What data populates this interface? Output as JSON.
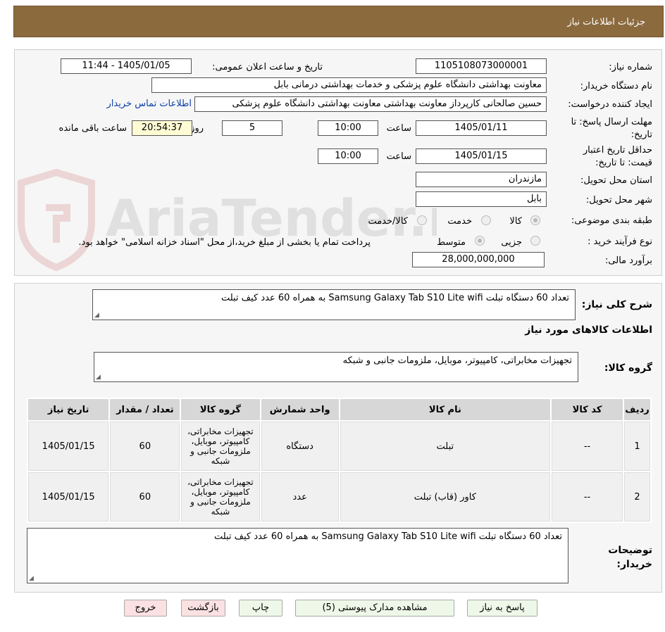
{
  "header": {
    "title": "جزئیات اطلاعات نیاز"
  },
  "form": {
    "need_number_label": "شماره نیاز:",
    "need_number": "1105108073000001",
    "announce_label": "تاریخ و ساعت اعلان عمومی:",
    "announce_value": "1405/01/05 - 11:44",
    "buyer_org_label": "نام دستگاه خریدار:",
    "buyer_org": "معاونت بهداشتی دانشگاه علوم پزشکی و خدمات بهداشتی درمانی بابل",
    "creator_label": "ایجاد کننده درخواست:",
    "creator": "حسین صالحانی کارپرداز معاونت بهداشتی معاونت بهداشتی دانشگاه علوم پزشکی",
    "contact_link": "اطلاعات تماس خریدار",
    "deadline_label": "مهلت ارسال پاسخ: تا تاریخ:",
    "deadline_date": "1405/01/11",
    "time_label": "ساعت",
    "deadline_time": "10:00",
    "days_value": "5",
    "days_label": "روز و",
    "remaining_value": "20:54:37",
    "remaining_label": "ساعت باقی مانده",
    "validity_label": "حداقل تاریخ اعتبار قیمت: تا تاریخ:",
    "validity_date": "1405/01/15",
    "validity_time_label": "ساعت",
    "validity_time": "10:00",
    "province_label": "استان محل تحویل:",
    "province": "مازندران",
    "city_label": "شهر محل تحویل:",
    "city": "بابل",
    "category_label": "طبقه بندی موضوعی:",
    "category_options": [
      "کالا",
      "خدمت",
      "کالا/خدمت"
    ],
    "category_selected": "کالا",
    "process_label": "نوع فرآیند خرید :",
    "process_options": [
      "جزیی",
      "متوسط"
    ],
    "process_selected": "متوسط",
    "payment_note": "پرداخت تمام یا بخشی از مبلغ خرید،از محل \"اسناد خزانه اسلامی\" خواهد بود.",
    "budget_label": "برآورد مالی:",
    "budget": "28,000,000,000"
  },
  "summary": {
    "label": "شرح کلی نیاز:",
    "text": "تعداد 60 دستگاه تبلت Samsung    Galaxy Tab S10  Lite wifi  به همراه   60 عدد کیف تبلت"
  },
  "goods": {
    "section_title": "اطلاعات کالاهای مورد نیاز",
    "group_label": "گروه کالا:",
    "group_value": "تجهیزات مخابراتی، کامپیوتر، موبایل، ملزومات جانبی و شبکه",
    "columns": [
      "ردیف",
      "کد کالا",
      "نام کالا",
      "واحد شمارش",
      "گروه کالا",
      "تعداد / مقدار",
      "تاریخ نیاز"
    ],
    "rows": [
      {
        "row": "1",
        "code": "--",
        "name": "تبلت",
        "unit": "دستگاه",
        "group": "تجهیزات مخابراتی، کامپیوتر، موبایل، ملزومات جانبی و شبکه",
        "qty": "60",
        "date": "1405/01/15"
      },
      {
        "row": "2",
        "code": "--",
        "name": "کاور (قاب) تبلت",
        "unit": "عدد",
        "group": "تجهیزات مخابراتی، کامپیوتر، موبایل، ملزومات جانبی و شبکه",
        "qty": "60",
        "date": "1405/01/15"
      }
    ]
  },
  "buyer_notes": {
    "label": "توضیحات خریدار:",
    "text": "تعداد 60 دستگاه تبلت Samsung    Galaxy Tab S10  Lite wifi  به همراه 60 عدد کیف تبلت"
  },
  "buttons": {
    "reply": "پاسخ به نیاز",
    "attachments": "مشاهده مدارک پیوستی (5)",
    "print": "چاپ",
    "back": "بازگشت",
    "exit": "خروج"
  },
  "watermark": {
    "text": "AriaTender.neT"
  },
  "colors": {
    "header": "#8b6a3e",
    "button_green": "#eef8e8",
    "button_pink": "#fbe1e1",
    "remaining_bg": "#fffbd4"
  }
}
